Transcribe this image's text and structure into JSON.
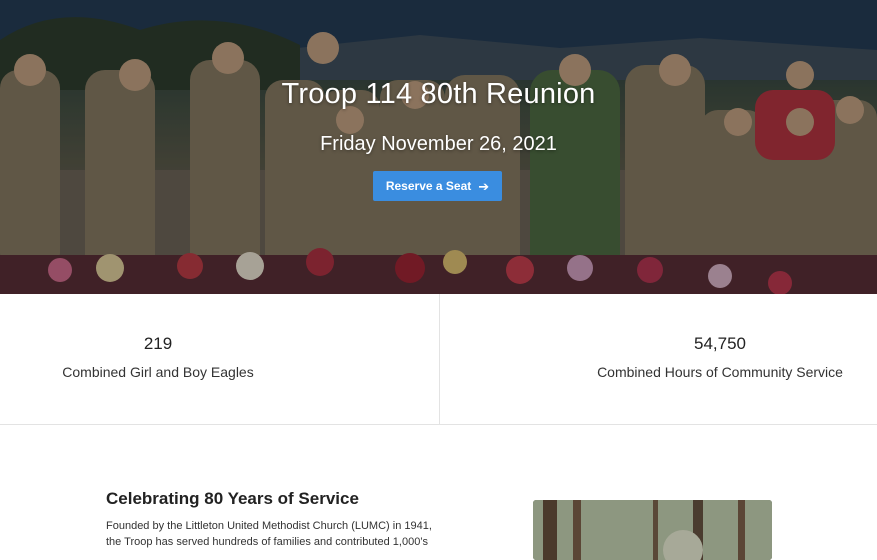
{
  "hero": {
    "title": "Troop 114 80th Reunion",
    "date": "Friday November 26, 2021",
    "cta_label": "Reserve a Seat",
    "cta_color": "#3a8de0",
    "cta_icon": "arrow-right-icon"
  },
  "stats": [
    {
      "value": "219",
      "label": "Combined Girl and Boy Eagles"
    },
    {
      "value": "54,750",
      "label": "Combined Hours of Community Service"
    }
  ],
  "about": {
    "title": "Celebrating 80 Years of Service",
    "text_line1": "Founded by the Littleton United Methodist Church (LUMC) in 1941,",
    "text_line2": "the Troop has served hundreds of families and contributed 1,000’s"
  }
}
